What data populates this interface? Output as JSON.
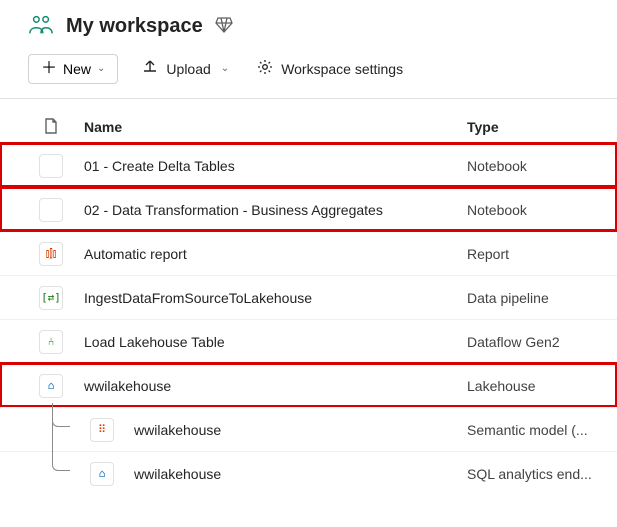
{
  "header": {
    "title": "My workspace"
  },
  "toolbar": {
    "new_label": "New",
    "upload_label": "Upload",
    "settings_label": "Workspace settings"
  },
  "columns": {
    "name": "Name",
    "type": "Type"
  },
  "items": [
    {
      "icon": "notebook-icon",
      "icon_color": "#107c10",
      "icon_glyph": "</>",
      "name": "01 - Create Delta Tables",
      "type": "Notebook",
      "highlight": true
    },
    {
      "icon": "notebook-icon",
      "icon_color": "#107c10",
      "icon_glyph": "</>",
      "name": "02 - Data Transformation - Business Aggregates",
      "type": "Notebook",
      "highlight": true
    },
    {
      "icon": "report-icon",
      "icon_color": "#d83b01",
      "icon_glyph": "⫾⫿⫾",
      "name": "Automatic report",
      "type": "Report",
      "highlight": false
    },
    {
      "icon": "pipeline-icon",
      "icon_color": "#107c10",
      "icon_glyph": "[⇄]",
      "name": "IngestDataFromSourceToLakehouse",
      "type": "Data pipeline",
      "highlight": false
    },
    {
      "icon": "dataflow-icon",
      "icon_color": "#107c10",
      "icon_glyph": "⑃",
      "name": "Load Lakehouse Table",
      "type": "Dataflow Gen2",
      "highlight": false
    },
    {
      "icon": "lakehouse-icon",
      "icon_color": "#0f6cbd",
      "icon_glyph": "⌂",
      "name": "wwilakehouse",
      "type": "Lakehouse",
      "highlight": true
    }
  ],
  "children": [
    {
      "icon": "semantic-model-icon",
      "icon_color": "#d83b01",
      "icon_glyph": "⠿",
      "name": "wwilakehouse",
      "type": "Semantic model (..."
    },
    {
      "icon": "sql-endpoint-icon",
      "icon_color": "#0f6cbd",
      "icon_glyph": "⌂",
      "name": "wwilakehouse",
      "type": "SQL analytics end..."
    }
  ]
}
